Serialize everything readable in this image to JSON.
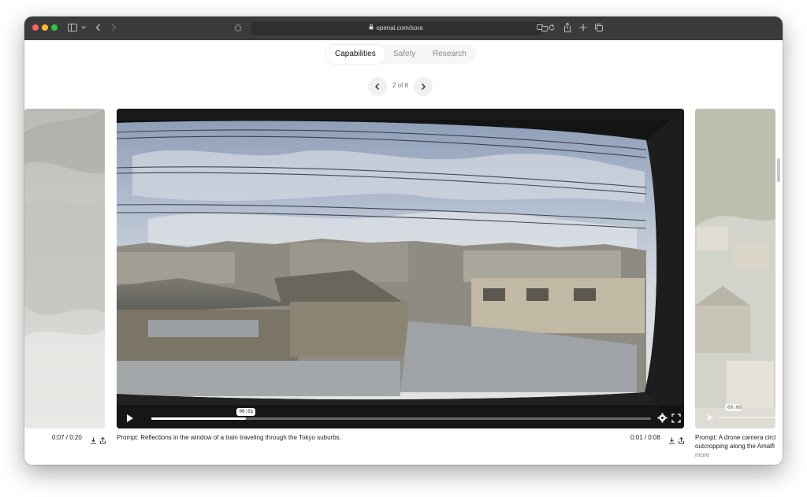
{
  "browser": {
    "url": "openai.com/sora",
    "colors": {
      "toolbar": "#3b3b3d",
      "close": "#fe5f57",
      "minimize": "#febc2e",
      "zoom": "#28c840"
    }
  },
  "tabs": [
    {
      "label": "Capabilities",
      "active": true
    },
    {
      "label": "Safety",
      "active": false
    },
    {
      "label": "Research",
      "active": false
    }
  ],
  "carousel": {
    "position": "2 of 8"
  },
  "left_item": {
    "time": "0:07 / 0:20"
  },
  "main_video": {
    "prompt": "Prompt: Reflections in the window of a train traveling through the Tokyo suburbs.",
    "time": "0:01 / 0:08",
    "scrub_time": "00:01",
    "progress": 0.19
  },
  "right_item": {
    "prompt_line1": "Prompt: A drone camera circle",
    "prompt_line2": "outcropping along the Amalfi",
    "more": "more",
    "scrub_time": "00:00"
  }
}
